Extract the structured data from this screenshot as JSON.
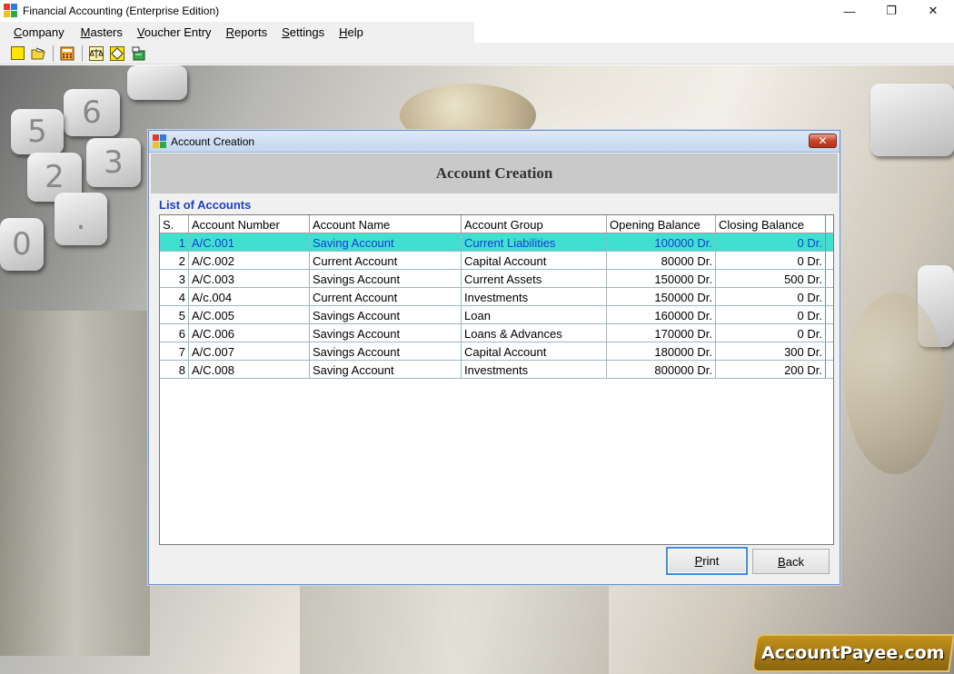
{
  "app": {
    "title": "Financial Accounting (Enterprise Edition)",
    "controls": {
      "minimize": "—",
      "maximize": "❐",
      "close": "✕"
    }
  },
  "menu": [
    {
      "pre": "",
      "ul": "C",
      "post": "ompany"
    },
    {
      "pre": "",
      "ul": "M",
      "post": "asters"
    },
    {
      "pre": "",
      "ul": "V",
      "post": "oucher Entry"
    },
    {
      "pre": "",
      "ul": "R",
      "post": "eports"
    },
    {
      "pre": "",
      "ul": "S",
      "post": "ettings"
    },
    {
      "pre": "",
      "ul": "H",
      "post": "elp"
    }
  ],
  "toolbar_icons": [
    "new-icon",
    "open-icon",
    "calculator-icon",
    "balance-scale-icon",
    "diamond-icon",
    "export-icon"
  ],
  "dialog": {
    "title": "Account Creation",
    "heading": "Account Creation",
    "close": "✕",
    "list_label": "List of Accounts",
    "columns": [
      "S.",
      "Account Number",
      "Account Name",
      "Account Group",
      "Opening Balance",
      "Closing Balance"
    ],
    "rows": [
      {
        "sn": "1",
        "number": "A/C.001",
        "name": "Saving Account",
        "group": "Current Liabilities",
        "opening": "100000 Dr.",
        "closing": "0 Dr."
      },
      {
        "sn": "2",
        "number": "A/C.002",
        "name": "Current Account",
        "group": "Capital Account",
        "opening": "80000 Dr.",
        "closing": "0 Dr."
      },
      {
        "sn": "3",
        "number": "A/C.003",
        "name": "Savings Account",
        "group": "Current Assets",
        "opening": "150000 Dr.",
        "closing": "500 Dr."
      },
      {
        "sn": "4",
        "number": "A/c.004",
        "name": "Current Account",
        "group": "Investments",
        "opening": "150000 Dr.",
        "closing": "0 Dr."
      },
      {
        "sn": "5",
        "number": "A/C.005",
        "name": "Savings Account",
        "group": "Loan",
        "opening": "160000 Dr.",
        "closing": "0 Dr."
      },
      {
        "sn": "6",
        "number": "A/C.006",
        "name": "Savings Account",
        "group": "Loans & Advances",
        "opening": "170000 Dr.",
        "closing": "0 Dr."
      },
      {
        "sn": "7",
        "number": "A/C.007",
        "name": "Savings Account",
        "group": "Capital Account",
        "opening": "180000 Dr.",
        "closing": "300 Dr."
      },
      {
        "sn": "8",
        "number": "A/C.008",
        "name": "Saving Account",
        "group": "Investments",
        "opening": "800000 Dr.",
        "closing": "200 Dr."
      }
    ],
    "selected_row": 0,
    "buttons": {
      "print": {
        "ul": "P",
        "rest": "rint"
      },
      "back": {
        "ul": "B",
        "rest": "ack"
      }
    }
  },
  "desktop_keys": [
    "6",
    "5",
    "2",
    "3",
    "0",
    "."
  ],
  "watermark": "AccountPayee.com",
  "colors": {
    "selection": "#40e0d0",
    "selection_text": "#1a3adb",
    "list_label": "#1f3fc8",
    "focus": "#3d8de0"
  }
}
